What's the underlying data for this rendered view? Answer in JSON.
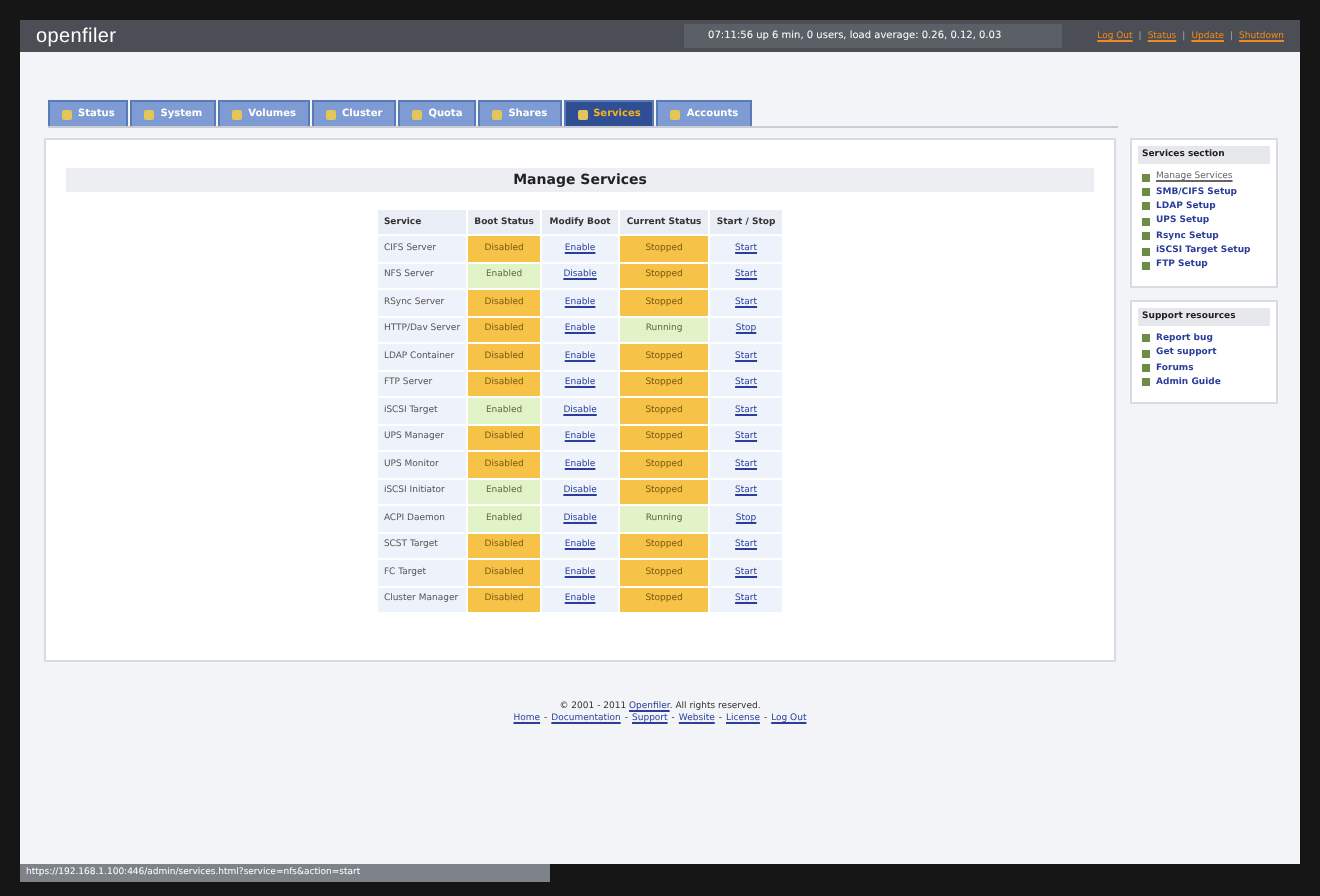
{
  "header": {
    "logo": "openfiler",
    "uptime": "07:11:56 up 6 min, 0 users, load average: 0.26, 0.12, 0.03",
    "links": [
      "Log Out",
      "Status",
      "Update",
      "Shutdown"
    ],
    "separator": "|"
  },
  "tabs": [
    {
      "label": "Status",
      "selected": false
    },
    {
      "label": "System",
      "selected": false
    },
    {
      "label": "Volumes",
      "selected": false
    },
    {
      "label": "Cluster",
      "selected": false
    },
    {
      "label": "Quota",
      "selected": false
    },
    {
      "label": "Shares",
      "selected": false
    },
    {
      "label": "Services",
      "selected": true
    },
    {
      "label": "Accounts",
      "selected": false
    }
  ],
  "main": {
    "title": "Manage Services",
    "table": {
      "columns": [
        "Service",
        "Boot Status",
        "Modify Boot",
        "Current Status",
        "Start / Stop"
      ],
      "rows": [
        {
          "service": "CIFS Server",
          "boot_status": "Disabled",
          "boot_enabled": false,
          "modify": "Enable",
          "current_status": "Stopped",
          "running": false,
          "action": "Start"
        },
        {
          "service": "NFS Server",
          "boot_status": "Enabled",
          "boot_enabled": true,
          "modify": "Disable",
          "current_status": "Stopped",
          "running": false,
          "action": "Start"
        },
        {
          "service": "RSync Server",
          "boot_status": "Disabled",
          "boot_enabled": false,
          "modify": "Enable",
          "current_status": "Stopped",
          "running": false,
          "action": "Start"
        },
        {
          "service": "HTTP/Dav Server",
          "boot_status": "Disabled",
          "boot_enabled": false,
          "modify": "Enable",
          "current_status": "Running",
          "running": true,
          "action": "Stop"
        },
        {
          "service": "LDAP Container",
          "boot_status": "Disabled",
          "boot_enabled": false,
          "modify": "Enable",
          "current_status": "Stopped",
          "running": false,
          "action": "Start"
        },
        {
          "service": "FTP Server",
          "boot_status": "Disabled",
          "boot_enabled": false,
          "modify": "Enable",
          "current_status": "Stopped",
          "running": false,
          "action": "Start"
        },
        {
          "service": "iSCSI Target",
          "boot_status": "Enabled",
          "boot_enabled": true,
          "modify": "Disable",
          "current_status": "Stopped",
          "running": false,
          "action": "Start"
        },
        {
          "service": "UPS Manager",
          "boot_status": "Disabled",
          "boot_enabled": false,
          "modify": "Enable",
          "current_status": "Stopped",
          "running": false,
          "action": "Start"
        },
        {
          "service": "UPS Monitor",
          "boot_status": "Disabled",
          "boot_enabled": false,
          "modify": "Enable",
          "current_status": "Stopped",
          "running": false,
          "action": "Start"
        },
        {
          "service": "iSCSI Initiator",
          "boot_status": "Enabled",
          "boot_enabled": true,
          "modify": "Disable",
          "current_status": "Stopped",
          "running": false,
          "action": "Start"
        },
        {
          "service": "ACPI Daemon",
          "boot_status": "Enabled",
          "boot_enabled": true,
          "modify": "Disable",
          "current_status": "Running",
          "running": true,
          "action": "Stop"
        },
        {
          "service": "SCST Target",
          "boot_status": "Disabled",
          "boot_enabled": false,
          "modify": "Enable",
          "current_status": "Stopped",
          "running": false,
          "action": "Start"
        },
        {
          "service": "FC Target",
          "boot_status": "Disabled",
          "boot_enabled": false,
          "modify": "Enable",
          "current_status": "Stopped",
          "running": false,
          "action": "Start"
        },
        {
          "service": "Cluster Manager",
          "boot_status": "Disabled",
          "boot_enabled": false,
          "modify": "Enable",
          "current_status": "Stopped",
          "running": false,
          "action": "Start"
        }
      ]
    }
  },
  "sidebar": [
    {
      "title": "Services section",
      "items": [
        {
          "label": "Manage Services",
          "selected": true
        },
        {
          "label": "SMB/CIFS Setup",
          "selected": false
        },
        {
          "label": "LDAP Setup",
          "selected": false
        },
        {
          "label": "UPS Setup",
          "selected": false
        },
        {
          "label": "Rsync Setup",
          "selected": false
        },
        {
          "label": "iSCSI Target Setup",
          "selected": false
        },
        {
          "label": "FTP Setup",
          "selected": false
        }
      ]
    },
    {
      "title": "Support resources",
      "items": [
        {
          "label": "Report bug",
          "selected": false
        },
        {
          "label": "Get support",
          "selected": false
        },
        {
          "label": "Forums",
          "selected": false
        },
        {
          "label": "Admin Guide",
          "selected": false
        }
      ]
    }
  ],
  "footer": {
    "copyright_before": "© 2001 - 2011",
    "copyright_link": "Openfiler",
    "copyright_after": ". All rights reserved.",
    "links": [
      "Home",
      "Documentation",
      "Support",
      "Website",
      "License",
      "Log Out"
    ],
    "separator": "-"
  },
  "status_bar": "https://192.168.1.100:446/admin/services.html?service=nfs&action=start"
}
